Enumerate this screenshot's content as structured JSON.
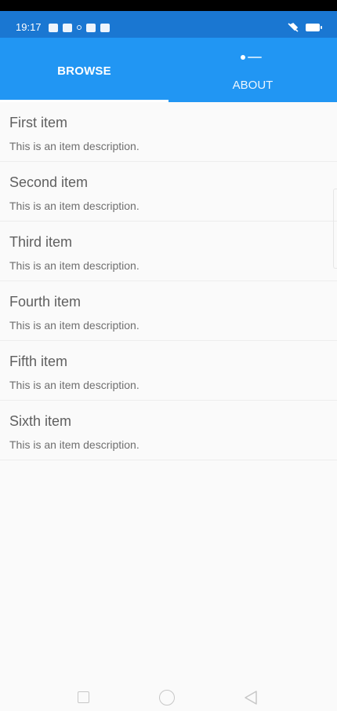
{
  "status_bar": {
    "time": "19:17"
  },
  "tabs": [
    {
      "label": "BROWSE",
      "selected": true
    },
    {
      "label": "ABOUT",
      "selected": false
    }
  ],
  "items": [
    {
      "title": "First item",
      "description": "This is an item description."
    },
    {
      "title": "Second item",
      "description": "This is an item description."
    },
    {
      "title": "Third item",
      "description": "This is an item description."
    },
    {
      "title": "Fourth item",
      "description": "This is an item description."
    },
    {
      "title": "Fifth item",
      "description": "This is an item description."
    },
    {
      "title": "Sixth item",
      "description": "This is an item description."
    }
  ],
  "colors": {
    "appbar": "#2196f3",
    "status_bar": "#1a77d2",
    "background": "#fafafa",
    "title_text": "#5f5f5f",
    "description_text": "#6f6f6f"
  },
  "icons": {
    "about_tab": "info-icon",
    "nav_recent": "square-icon",
    "nav_home": "circle-icon",
    "nav_back": "triangle-back-icon"
  }
}
